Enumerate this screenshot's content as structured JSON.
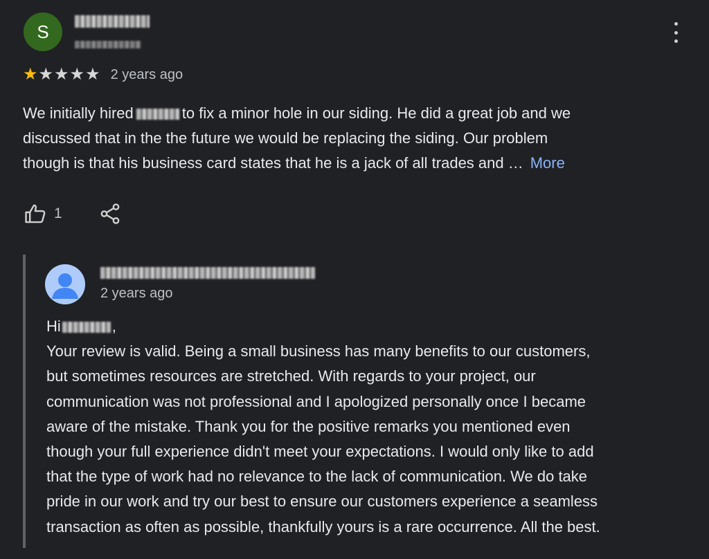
{
  "review": {
    "avatar_letter": "S",
    "avatar_color": "#33691e",
    "rating": 1,
    "max_rating": 5,
    "date": "2 years ago",
    "text_line1_a": "We initially hired",
    "text_line1_b": "to fix a minor hole in our siding. He did a great job and we",
    "text_line2": "discussed that in the the future we would be replacing the siding. Our problem",
    "text_line3": "though is that his business card states that he is a jack of all trades and …",
    "more_label": "More",
    "like_count": "1",
    "icons": [
      "more-vert-icon",
      "star-icon",
      "thumb-up-icon",
      "share-icon"
    ]
  },
  "owner_reply": {
    "date": "2 years ago",
    "greeting_prefix": "Hi",
    "greeting_suffix": ",",
    "lines": [
      "Your review is valid. Being a small business has many benefits to our customers,",
      "but sometimes resources are stretched. With regards to your project, our",
      "communication was not professional and I apologized personally once I became",
      "aware of the mistake. Thank you for the positive remarks you mentioned even",
      "though your full experience didn't meet your expectations. I would only like to add",
      "that the type of work had no relevance to the lack of communication. We do take",
      "pride in our work and try our best to ensure our customers experience a seamless",
      "transaction as often as possible, thankfully yours is a rare occurrence. All the best."
    ],
    "accent_color": "#8ab4f8"
  }
}
